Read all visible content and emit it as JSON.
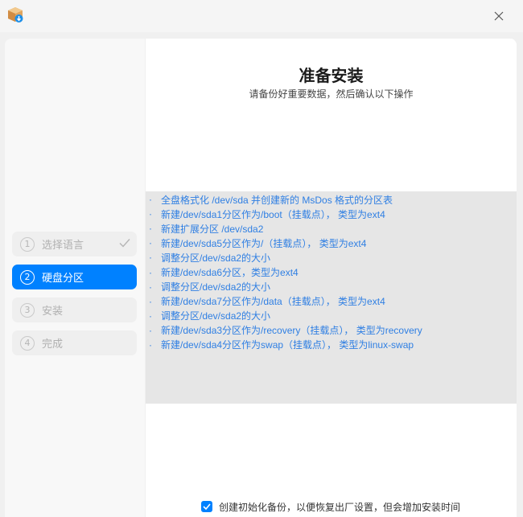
{
  "window": {
    "app_icon": "installer-package-icon",
    "close_icon": "close-icon"
  },
  "sidebar": {
    "steps": [
      {
        "number": "1",
        "label": "选择语言",
        "state": "done"
      },
      {
        "number": "2",
        "label": "硬盘分区",
        "state": "active"
      },
      {
        "number": "3",
        "label": "安装",
        "state": "pending"
      },
      {
        "number": "4",
        "label": "完成",
        "state": "pending"
      }
    ]
  },
  "main": {
    "title": "准备安装",
    "subtitle": "请备份好重要数据，然后确认以下操作",
    "bullet": "·",
    "operations": [
      "全盘格式化 /dev/sda 并创建新的 MsDos 格式的分区表",
      "新建/dev/sda1分区作为/boot（挂载点）， 类型为ext4",
      "新建扩展分区 /dev/sda2",
      "新建/dev/sda5分区作为/（挂载点）， 类型为ext4",
      "调整分区/dev/sda2的大小",
      "新建/dev/sda6分区，类型为ext4",
      "调整分区/dev/sda2的大小",
      "新建/dev/sda7分区作为/data（挂载点）， 类型为ext4",
      "调整分区/dev/sda2的大小",
      "新建/dev/sda3分区作为/recovery（挂载点）， 类型为recovery",
      "新建/dev/sda4分区作为swap（挂载点）， 类型为linux-swap"
    ],
    "backup_option": {
      "label": "创建初始化备份，以便恢复出厂设置，但会增加安装时间",
      "checked": true
    }
  },
  "colors": {
    "accent": "#0081ff",
    "link_text": "#2f7fe3",
    "ops_background": "#e6e6e6"
  }
}
